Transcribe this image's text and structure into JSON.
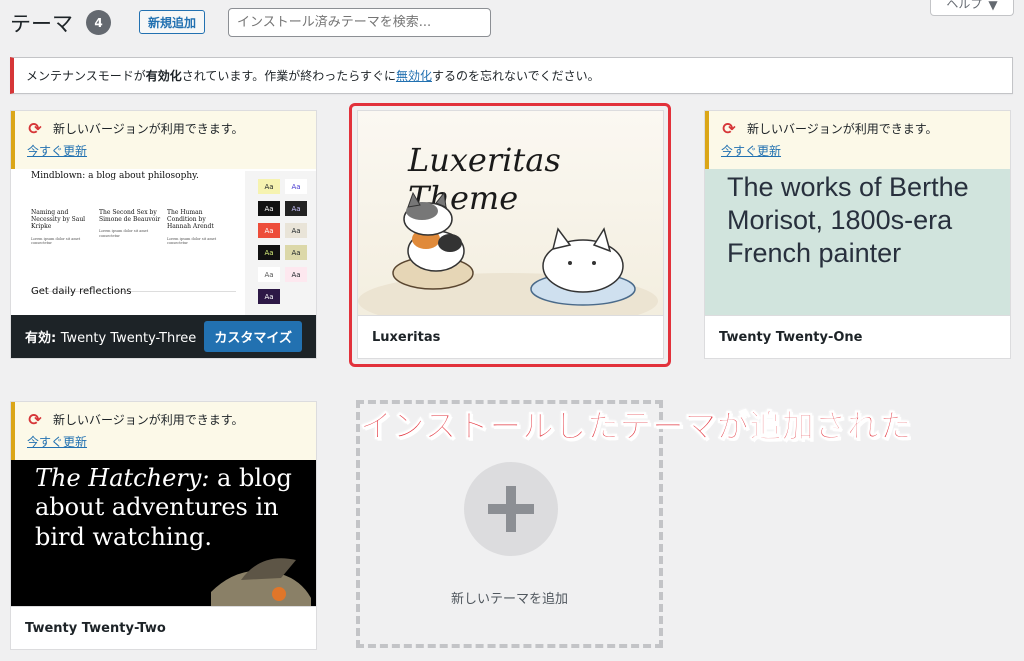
{
  "header": {
    "title": "テーマ",
    "count": "4",
    "add_new": "新規追加",
    "search_placeholder": "インストール済みテーマを検索...",
    "help": "ヘルプ"
  },
  "notice": {
    "part1": "メンテナンスモードが",
    "bold": "有効化",
    "part2": "されています。作業が終わったらすぐに",
    "link": "無効化",
    "part3": "するのを忘れないでください。"
  },
  "update": {
    "message": "新しいバージョンが利用できます。",
    "link": "今すぐ更新"
  },
  "themes": [
    {
      "name": "Twenty Twenty-Three",
      "active_label": "有効:",
      "customize": "カスタマイズ",
      "preview": {
        "blog": "Mindblown: a blog about philosophy.",
        "posts": [
          {
            "title": "Naming and Necessity by Saul Kripke"
          },
          {
            "title": "The Second Sex by Simone de Beauvoir"
          },
          {
            "title": "The Human Condition by Hannah Arendt"
          }
        ],
        "daily": "Get daily reflections",
        "swatch": "Aa"
      }
    },
    {
      "name": "Luxeritas",
      "preview": {
        "title": "Luxeritas Theme"
      }
    },
    {
      "name": "Twenty Twenty-One",
      "preview": {
        "headline": "The works of Berthe Morisot, 1800s-era French painter"
      }
    },
    {
      "name": "Twenty Twenty-Two",
      "preview": {
        "headline_italic": "The Hatchery:",
        "headline_rest": "a blog about adventures in bird watching."
      }
    }
  ],
  "add_new_theme": "新しいテーマを追加",
  "annotation": "インストールしたテーマが追加された",
  "colors": {
    "accent": "#2271b1",
    "alert": "#d63638",
    "highlight": "#e2313b",
    "warning": "#dba617"
  }
}
